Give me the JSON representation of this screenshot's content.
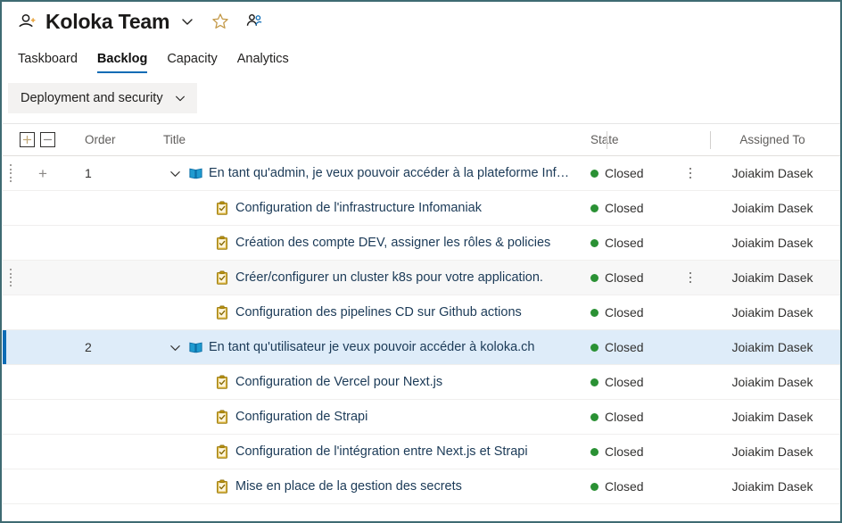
{
  "header": {
    "team_name": "Koloka Team",
    "team_icon": "team-people-icon",
    "chevron_icon": "chevron-down-icon",
    "favorite_icon": "star-outline-icon",
    "members_icon": "people-group-icon"
  },
  "tabs": [
    {
      "label": "Taskboard",
      "active": false
    },
    {
      "label": "Backlog",
      "active": true
    },
    {
      "label": "Capacity",
      "active": false
    },
    {
      "label": "Analytics",
      "active": false
    }
  ],
  "filter": {
    "iteration_label": "Deployment and security",
    "chevron_icon": "chevron-down-icon"
  },
  "grid": {
    "expand_all_label": "+",
    "collapse_all_label": "−",
    "columns": {
      "order": "Order",
      "title": "Title",
      "state": "State",
      "assigned_to": "Assigned To"
    },
    "add_row_label": "+",
    "rows": [
      {
        "order": "1",
        "title": "En tant qu'admin, je veux pouvoir accéder à la plateforme Infomaniak",
        "type": "user-story",
        "icon": "book-icon",
        "level": 0,
        "expanded": true,
        "state": "Closed",
        "assigned_to": "Joiakim Dasek",
        "show_add": true,
        "show_menu": true,
        "show_drag": true,
        "selected": false,
        "hovered": false
      },
      {
        "order": "",
        "title": "Configuration de l'infrastructure Infomaniak",
        "type": "task",
        "icon": "clipboard-check-icon",
        "level": 1,
        "expanded": null,
        "state": "Closed",
        "assigned_to": "Joiakim Dasek",
        "show_add": false,
        "show_menu": false,
        "show_drag": false,
        "selected": false,
        "hovered": false
      },
      {
        "order": "",
        "title": "Création des compte DEV, assigner les rôles & policies",
        "type": "task",
        "icon": "clipboard-check-icon",
        "level": 1,
        "expanded": null,
        "state": "Closed",
        "assigned_to": "Joiakim Dasek",
        "show_add": false,
        "show_menu": false,
        "show_drag": false,
        "selected": false,
        "hovered": false
      },
      {
        "order": "",
        "title": "Créer/configurer un cluster k8s pour votre application.",
        "type": "task",
        "icon": "clipboard-check-icon",
        "level": 1,
        "expanded": null,
        "state": "Closed",
        "assigned_to": "Joiakim Dasek",
        "show_add": false,
        "show_menu": true,
        "show_drag": true,
        "selected": false,
        "hovered": true
      },
      {
        "order": "",
        "title": "Configuration des pipelines CD sur Github actions",
        "type": "task",
        "icon": "clipboard-check-icon",
        "level": 1,
        "expanded": null,
        "state": "Closed",
        "assigned_to": "Joiakim Dasek",
        "show_add": false,
        "show_menu": false,
        "show_drag": false,
        "selected": false,
        "hovered": false
      },
      {
        "order": "2",
        "title": "En tant qu'utilisateur je veux pouvoir accéder à koloka.ch",
        "type": "user-story",
        "icon": "book-icon",
        "level": 0,
        "expanded": true,
        "state": "Closed",
        "assigned_to": "Joiakim Dasek",
        "show_add": false,
        "show_menu": false,
        "show_drag": false,
        "selected": true,
        "hovered": false
      },
      {
        "order": "",
        "title": "Configuration de Vercel pour Next.js",
        "type": "task",
        "icon": "clipboard-check-icon",
        "level": 1,
        "expanded": null,
        "state": "Closed",
        "assigned_to": "Joiakim Dasek",
        "show_add": false,
        "show_menu": false,
        "show_drag": false,
        "selected": false,
        "hovered": false
      },
      {
        "order": "",
        "title": "Configuration de Strapi",
        "type": "task",
        "icon": "clipboard-check-icon",
        "level": 1,
        "expanded": null,
        "state": "Closed",
        "assigned_to": "Joiakim Dasek",
        "show_add": false,
        "show_menu": false,
        "show_drag": false,
        "selected": false,
        "hovered": false
      },
      {
        "order": "",
        "title": "Configuration de l'intégration entre Next.js et Strapi",
        "type": "task",
        "icon": "clipboard-check-icon",
        "level": 1,
        "expanded": null,
        "state": "Closed",
        "assigned_to": "Joiakim Dasek",
        "show_add": false,
        "show_menu": false,
        "show_drag": false,
        "selected": false,
        "hovered": false
      },
      {
        "order": "",
        "title": "Mise en place de la gestion des secrets",
        "type": "task",
        "icon": "clipboard-check-icon",
        "level": 1,
        "expanded": null,
        "state": "Closed",
        "assigned_to": "Joiakim Dasek",
        "show_add": false,
        "show_menu": false,
        "show_drag": false,
        "selected": false,
        "hovered": false
      }
    ]
  },
  "colors": {
    "accent": "#0d6cb5",
    "state_closed": "#2a9134",
    "selected_row": "#deecf9",
    "task_icon": "#c8a005",
    "story_icon": "#009ccc",
    "frame_border": "#3f6b72"
  }
}
